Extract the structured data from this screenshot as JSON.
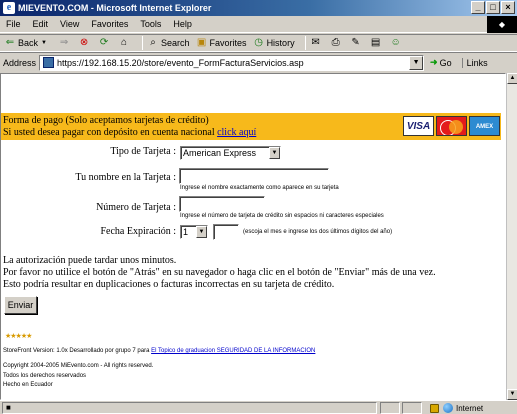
{
  "window": {
    "title": "MIEVENTO.COM - Microsoft Internet Explorer",
    "min_label": "_",
    "max_label": "□",
    "close_label": "×"
  },
  "menu": {
    "items": [
      "File",
      "Edit",
      "View",
      "Favorites",
      "Tools",
      "Help"
    ]
  },
  "toolbar": {
    "back_label": "Back",
    "search_label": "Search",
    "favorites_label": "Favorites",
    "history_label": "History"
  },
  "address": {
    "label": "Address",
    "url": "https://192.168.15.20/store/evento_FormFacturaServicios.asp",
    "go_label": "Go",
    "links_label": "Links"
  },
  "payment": {
    "line1": "Forma de pago (Solo aceptamos tarjetas de crédito)",
    "line2_prefix": "Si usted desea pagar con depósito en cuenta nacional",
    "line2_link": "click aquí",
    "cards": [
      "VISA",
      "MasterCard",
      "AMEX"
    ]
  },
  "form": {
    "card_type_label": "Tipo de Tarjeta :",
    "card_type_value": "American Express",
    "name_label": "Tu nombre en la Tarjeta :",
    "name_value": "",
    "name_hint": "Ingrese el nombre exactamente como aparece en su tarjeta",
    "number_label": "Número de Tarjeta :",
    "number_value": "",
    "number_hint": "Ingrese el número de tarjeta de crédito sin espacios ni caracteres especiales",
    "expiry_label": "Fecha Expiración :",
    "expiry_month": "1",
    "expiry_year": "",
    "expiry_hint": "(escoja el mes e ingrese los dos últimos dígitos del año)"
  },
  "notes": {
    "line1": "La autorización puede tardar unos minutos.",
    "line2": "Por favor no utilice el botón de \"Atrás\" en su navegador o haga clic en el botón de \"Enviar\" más de una vez.",
    "line3": "Esto podría resultar en duplicaciones o facturas incorrectas en su tarjeta de crédito."
  },
  "submit_label": "Enviar",
  "footer": {
    "stars": "★★★★★",
    "version_prefix": "StoreFront Version: 1.0x Desarrollado por grupo 7 para",
    "version_link": "El Topico de graduacion SEGURIDAD DE LA INFORMACION",
    "copyright": "Copyright 2004-2005 MiEvento.com - All rights reserved.",
    "rights": "Todos los derechos reservados",
    "made_in": "Hecho en Ecuador"
  },
  "status": {
    "zone_label": "Internet"
  }
}
